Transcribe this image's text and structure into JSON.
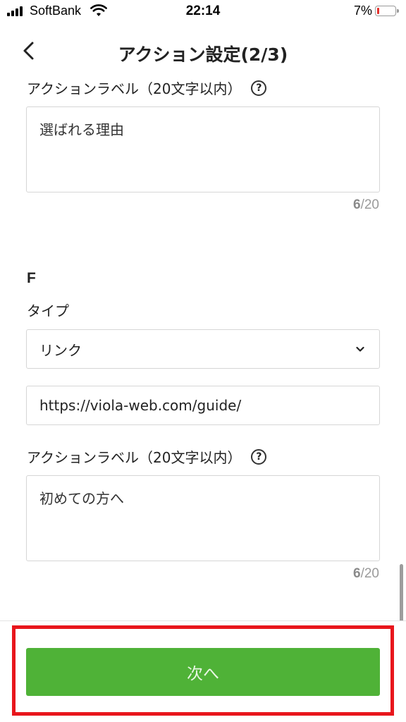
{
  "status_bar": {
    "carrier": "SoftBank",
    "time": "22:14",
    "battery_percent": "7%",
    "battery_level": 0.07,
    "battery_color": "#e5322d"
  },
  "header": {
    "title": "アクション設定(2/3)",
    "back_icon": "chevron-left-icon"
  },
  "sections": {
    "e": {
      "action_label_title": "アクションラベル（20文字以内）",
      "action_label_value": "選ばれる理由",
      "counter_current": "6",
      "counter_max": "/20"
    },
    "f": {
      "letter": "F",
      "type_label": "タイプ",
      "type_value": "リンク",
      "url_value": "https://viola-web.com/guide/",
      "action_label_title": "アクションラベル（20文字以内）",
      "action_label_value": "初めての方へ",
      "counter_current": "6",
      "counter_max": "/20"
    }
  },
  "help_icon_glyph": "?",
  "footer": {
    "next_label": "次へ",
    "button_color": "#4fb237"
  },
  "highlight_color": "#e8161c"
}
